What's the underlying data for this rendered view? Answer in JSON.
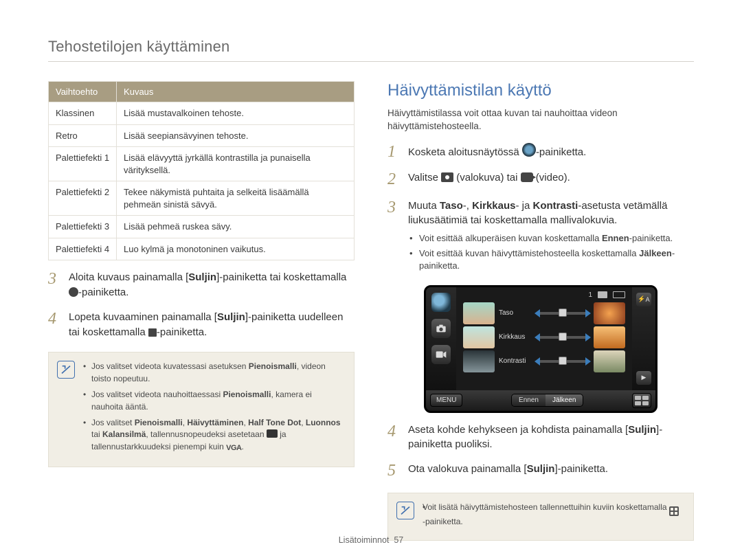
{
  "page_title": "Tehostetilojen käyttäminen",
  "footer": {
    "section": "Lisätoiminnot",
    "page": "57"
  },
  "table": {
    "headers": {
      "opt": "Vaihtoehto",
      "desc": "Kuvaus"
    },
    "rows": [
      {
        "opt": "Klassinen",
        "desc": "Lisää mustavalkoinen tehoste."
      },
      {
        "opt": "Retro",
        "desc": "Lisää seepiansävyinen tehoste."
      },
      {
        "opt": "Palettiefekti 1",
        "desc": "Lisää elävyyttä jyrkällä kontrastilla ja punaisella värityksellä."
      },
      {
        "opt": "Palettiefekti 2",
        "desc": "Tekee näkymistä puhtaita ja selkeitä lisäämällä pehmeän sinistä sävyä."
      },
      {
        "opt": "Palettiefekti 3",
        "desc": "Lisää pehmeä ruskea sävy."
      },
      {
        "opt": "Palettiefekti 4",
        "desc": "Luo kylmä ja monotoninen vaikutus."
      }
    ]
  },
  "left_steps": {
    "s3_a": "Aloita kuvaus painamalla [",
    "s3_b": "Suljin",
    "s3_c": "]-painiketta tai koskettamalla ",
    "s3_d": "-painiketta.",
    "s4_a": "Lopeta kuvaaminen painamalla [",
    "s4_b": "Suljin",
    "s4_c": "]-painiketta uudelleen tai koskettamalla ",
    "s4_d": "-painiketta."
  },
  "left_note": {
    "n1_a": "Jos valitset videota kuvatessasi asetuksen ",
    "n1_b": "Pienoismalli",
    "n1_c": ", videon toisto nopeutuu.",
    "n2_a": "Jos valitset videota nauhoittaessasi ",
    "n2_b": "Pienoismalli",
    "n2_c": ", kamera ei nauhoita ääntä.",
    "n3_a": "Jos valitset ",
    "n3_b": "Pienoismalli",
    "n3_c": ", ",
    "n3_d": "Häivyttäminen",
    "n3_e": ", ",
    "n3_f": "Half Tone Dot",
    "n3_g": ", ",
    "n3_h": "Luonnos",
    "n3_i": " tai ",
    "n3_j": "Kalansilmä",
    "n3_k": ", tallennusnopeudeksi asetetaan ",
    "n3_l": " ja tallennustarkkuudeksi pienempi kuin ",
    "n3_m": "."
  },
  "right": {
    "heading": "Häivyttämistilan käyttö",
    "intro": "Häivyttämistilassa voit ottaa kuvan tai nauhoittaa videon häivyttämistehosteella.",
    "step1_a": "Kosketa aloitusnäytössä ",
    "step1_b": "-painiketta.",
    "step2_a": "Valitse ",
    "step2_b": " (valokuva) tai ",
    "step2_c": " (video).",
    "step3_a": "Muuta ",
    "step3_b": "Taso",
    "step3_c": "-, ",
    "step3_d": "Kirkkaus",
    "step3_e": "- ja ",
    "step3_f": "Kontrasti",
    "step3_g": "-asetusta vetämällä liukusäätimiä tai koskettamalla mallivalokuvia.",
    "step3_sub1_a": "Voit esittää alkuperäisen kuvan koskettamalla ",
    "step3_sub1_b": "Ennen",
    "step3_sub1_c": "-painiketta.",
    "step3_sub2_a": "Voit esittää kuvan häivyttämistehosteella koskettamalla ",
    "step3_sub2_b": "Jälkeen",
    "step3_sub2_c": "-painiketta.",
    "step4_a": "Aseta kohde kehykseen ja kohdista painamalla [",
    "step4_b": "Suljin",
    "step4_c": "]-painiketta puoliksi.",
    "step5_a": "Ota valokuva painamalla [",
    "step5_b": "Suljin",
    "step5_c": "]-painiketta.",
    "note_a": "Voit lisätä häivyttämistehosteen tallennettuihin kuviin koskettamalla ",
    "note_b": " -painiketta."
  },
  "camera_ui": {
    "count": "1",
    "menu": "MENU",
    "before": "Ennen",
    "after": "Jälkeen",
    "labels": {
      "taso": "Taso",
      "kirkkaus": "Kirkkaus",
      "kontrasti": "Kontrasti"
    },
    "flash": "A"
  },
  "vga_label": "VGA"
}
